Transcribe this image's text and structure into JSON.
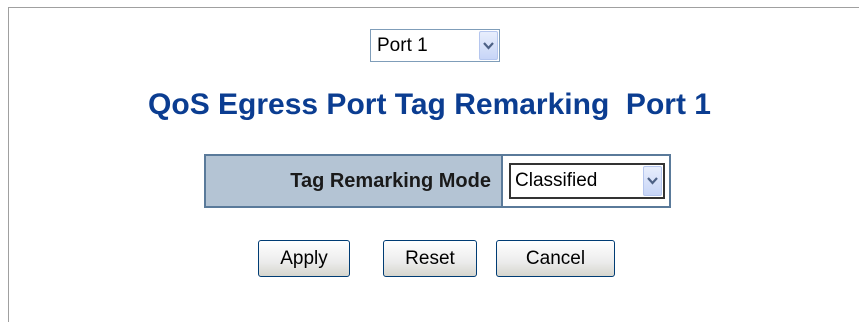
{
  "port_selector": {
    "value": "Port 1",
    "icon": "chevron-down-icon"
  },
  "page": {
    "title": "QoS Egress Port Tag Remarking  Port 1"
  },
  "config": {
    "label": "Tag Remarking Mode",
    "mode_value": "Classified"
  },
  "buttons": {
    "apply": "Apply",
    "reset": "Reset",
    "cancel": "Cancel"
  }
}
